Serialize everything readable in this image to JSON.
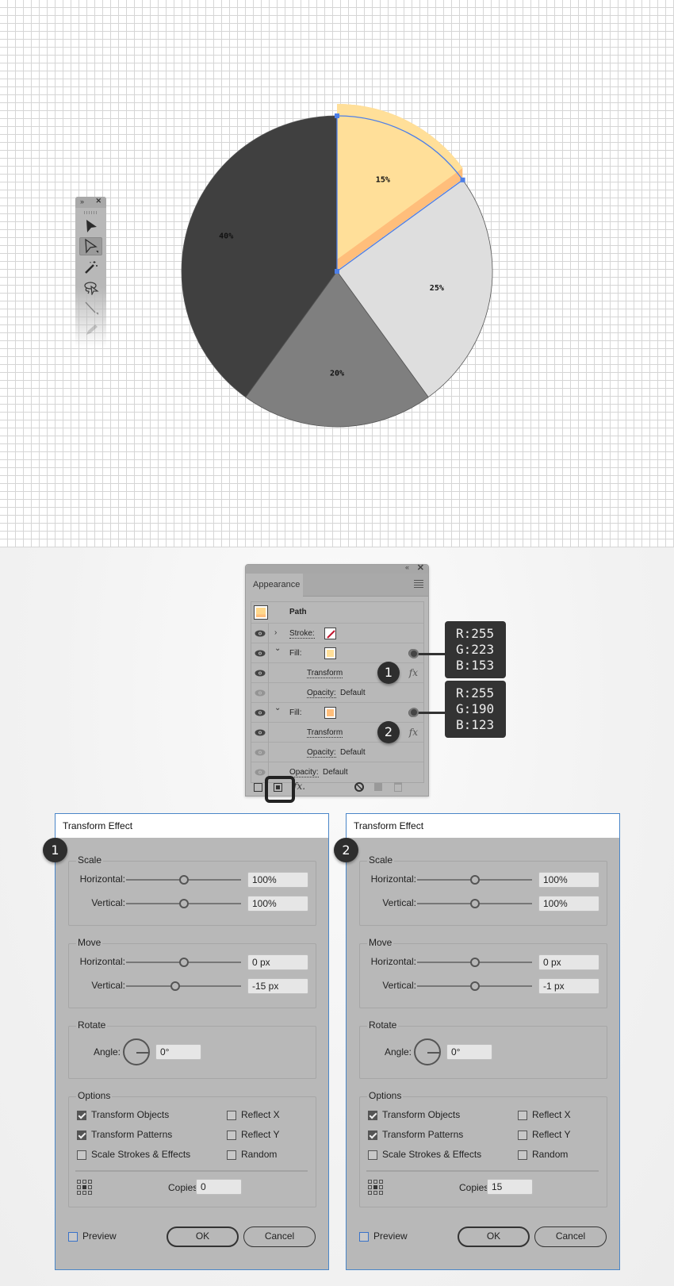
{
  "chart_data": {
    "type": "pie",
    "title": "",
    "slices": [
      {
        "label": "15%",
        "value": 15,
        "color": "#FFDF99",
        "highlighted": true
      },
      {
        "label": "25%",
        "value": 25,
        "color": "#DEDEDE"
      },
      {
        "label": "20%",
        "value": 20,
        "color": "#7F7F7F"
      },
      {
        "label": "40%",
        "value": 40,
        "color": "#404040"
      }
    ],
    "start_angle_deg": 0,
    "direction": "clockwise",
    "extrusion": {
      "top_color": "#FFDF99",
      "side_color": "#FFBE7B",
      "offset_px_label": "-15 px",
      "copies": 15
    },
    "selection_color": "#4D7FE8"
  },
  "toolbar": {
    "collapse_icon": "»",
    "close_icon": "✕",
    "tools": [
      "selection-tool",
      "direct-selection-tool",
      "magic-wand-tool",
      "lasso-tool",
      "line-tool",
      "pencil-tool"
    ],
    "active_tool": "direct-selection-tool"
  },
  "appearance": {
    "tab_label": "Appearance",
    "collapse_icon": "«",
    "close_icon": "✕",
    "object_label": "Path",
    "object_swatch": "#FFD88C",
    "rows": [
      {
        "type": "stroke",
        "label": "Stroke:",
        "swatch": "none",
        "expanded": false
      },
      {
        "type": "fill",
        "label": "Fill:",
        "swatch": "#FFDF99",
        "expanded": true
      },
      {
        "type": "effect",
        "label": "Transform",
        "fx": "fx",
        "badge": "1"
      },
      {
        "type": "opacity",
        "label": "Opacity:",
        "value": "Default"
      },
      {
        "type": "fill",
        "label": "Fill:",
        "swatch": "#FFBE7B",
        "expanded": true
      },
      {
        "type": "effect",
        "label": "Transform",
        "fx": "fx",
        "badge": "2"
      },
      {
        "type": "opacity",
        "label": "Opacity:",
        "value": "Default"
      },
      {
        "type": "opacity-root",
        "label": "Opacity:",
        "value": "Default"
      }
    ],
    "footer": {
      "fx_label": "fx."
    }
  },
  "callouts": [
    {
      "r": "R:255",
      "g": "G:223",
      "b": "B:153"
    },
    {
      "r": "R:255",
      "g": "G:190",
      "b": "B:123"
    }
  ],
  "dialogs": [
    {
      "badge": "1",
      "title": "Transform Effect",
      "scale": {
        "title": "Scale",
        "h_label": "Horizontal:",
        "h_value": "100%",
        "v_label": "Vertical:",
        "v_value": "100%",
        "h_slider": 0.5,
        "v_slider": 0.5
      },
      "move": {
        "title": "Move",
        "h_label": "Horizontal:",
        "h_value": "0 px",
        "v_label": "Vertical:",
        "v_value": "-15 px",
        "h_slider": 0.5,
        "v_slider": 0.43
      },
      "rotate": {
        "title": "Rotate",
        "angle_label": "Angle:",
        "angle_value": "0°"
      },
      "options": {
        "title": "Options",
        "transform_objects": {
          "label": "Transform Objects",
          "checked": true
        },
        "transform_patterns": {
          "label": "Transform Patterns",
          "checked": true
        },
        "scale_strokes": {
          "label": "Scale Strokes & Effects",
          "checked": false
        },
        "reflect_x": {
          "label": "Reflect X",
          "checked": false
        },
        "reflect_y": {
          "label": "Reflect Y",
          "checked": false
        },
        "random": {
          "label": "Random",
          "checked": false
        },
        "copies_label": "Copies",
        "copies_value": "0"
      },
      "preview_label": "Preview",
      "ok_label": "OK",
      "cancel_label": "Cancel"
    },
    {
      "badge": "2",
      "title": "Transform Effect",
      "scale": {
        "title": "Scale",
        "h_label": "Horizontal:",
        "h_value": "100%",
        "v_label": "Vertical:",
        "v_value": "100%",
        "h_slider": 0.5,
        "v_slider": 0.5
      },
      "move": {
        "title": "Move",
        "h_label": "Horizontal:",
        "h_value": "0 px",
        "v_label": "Vertical:",
        "v_value": "-1 px",
        "h_slider": 0.5,
        "v_slider": 0.5
      },
      "rotate": {
        "title": "Rotate",
        "angle_label": "Angle:",
        "angle_value": "0°"
      },
      "options": {
        "title": "Options",
        "transform_objects": {
          "label": "Transform Objects",
          "checked": true
        },
        "transform_patterns": {
          "label": "Transform Patterns",
          "checked": true
        },
        "scale_strokes": {
          "label": "Scale Strokes & Effects",
          "checked": false
        },
        "reflect_x": {
          "label": "Reflect X",
          "checked": false
        },
        "reflect_y": {
          "label": "Reflect Y",
          "checked": false
        },
        "random": {
          "label": "Random",
          "checked": false
        },
        "copies_label": "Copies",
        "copies_value": "15"
      },
      "preview_label": "Preview",
      "ok_label": "OK",
      "cancel_label": "Cancel"
    }
  ]
}
